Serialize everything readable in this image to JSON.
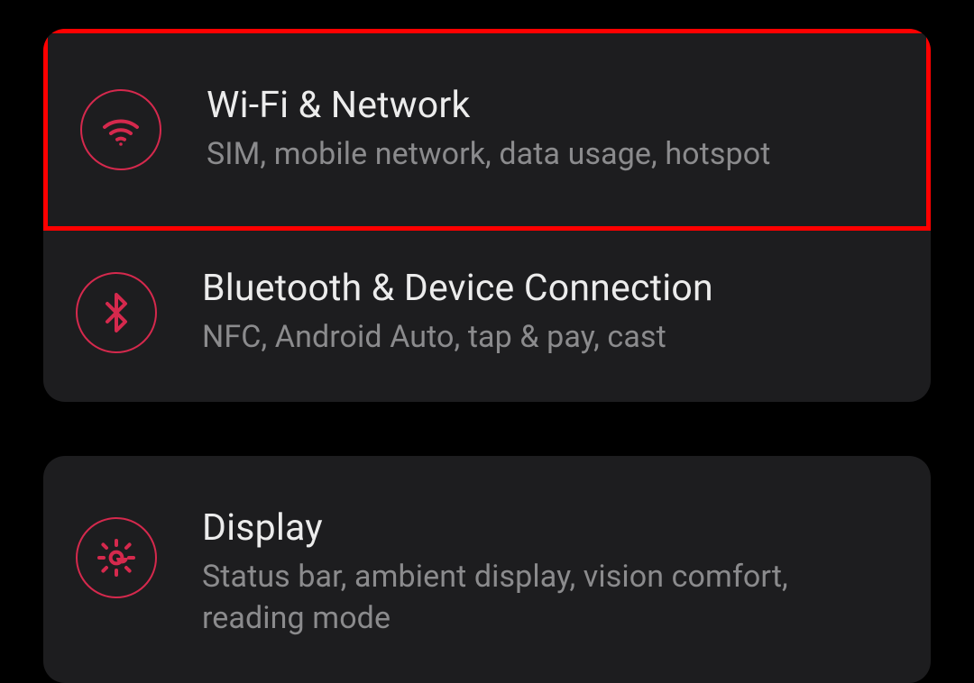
{
  "colors": {
    "accent": "#d5294d",
    "highlight_border": "#ff0000",
    "card_bg": "#1d1d1f",
    "page_bg": "#000000",
    "title_fg": "#ececec",
    "subtitle_fg": "#8b8b8d"
  },
  "settings": {
    "group1": {
      "wifi": {
        "icon": "wifi-icon",
        "title": "Wi-Fi & Network",
        "subtitle": "SIM, mobile network, data usage, hotspot",
        "highlighted": true
      },
      "bluetooth": {
        "icon": "bluetooth-icon",
        "title": "Bluetooth & Device Connection",
        "subtitle": "NFC, Android Auto, tap & pay, cast",
        "highlighted": false
      }
    },
    "group2": {
      "display": {
        "icon": "brightness-icon",
        "title": "Display",
        "subtitle": "Status bar, ambient display, vision comfort, reading mode",
        "highlighted": false
      }
    }
  }
}
